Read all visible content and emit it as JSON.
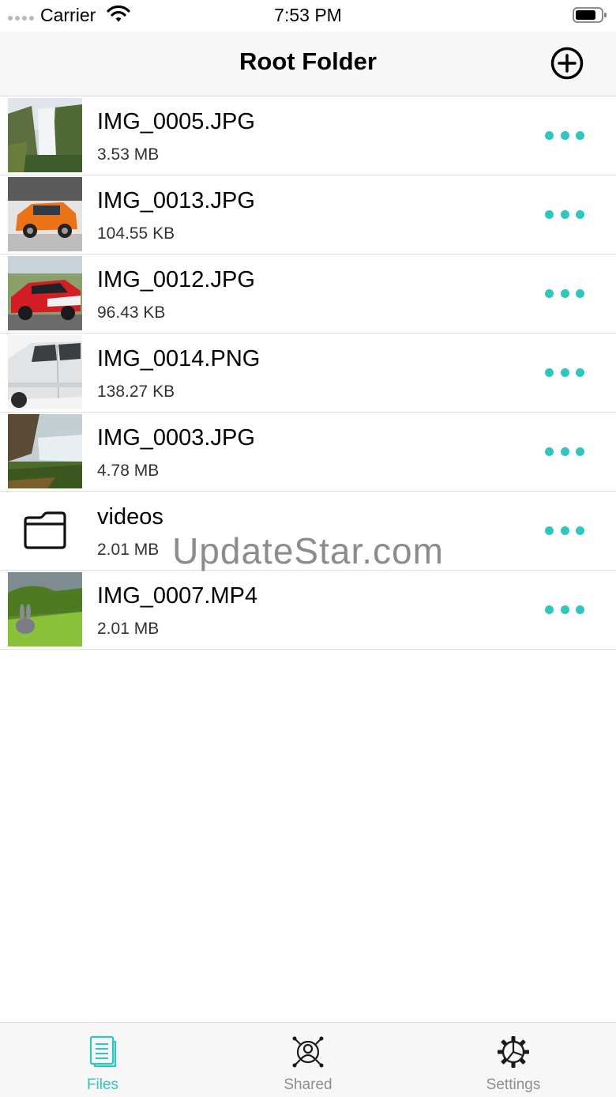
{
  "status_bar": {
    "carrier": "Carrier",
    "time": "7:53 PM"
  },
  "nav": {
    "title": "Root Folder",
    "add_icon": "plus-circle-icon"
  },
  "files": [
    {
      "name": "IMG_0005.JPG",
      "size": "3.53 MB",
      "kind": "image",
      "thumb": "waterfall"
    },
    {
      "name": "IMG_0013.JPG",
      "size": "104.55 KB",
      "kind": "image",
      "thumb": "orange-car"
    },
    {
      "name": "IMG_0012.JPG",
      "size": "96.43 KB",
      "kind": "image",
      "thumb": "race-car"
    },
    {
      "name": "IMG_0014.PNG",
      "size": "138.27 KB",
      "kind": "image",
      "thumb": "white-car"
    },
    {
      "name": "IMG_0003.JPG",
      "size": "4.78 MB",
      "kind": "image",
      "thumb": "cliff-falls"
    },
    {
      "name": "videos",
      "size": "2.01 MB",
      "kind": "folder",
      "thumb": "folder-icon"
    },
    {
      "name": "IMG_0007.MP4",
      "size": "2.01 MB",
      "kind": "video",
      "thumb": "grass-bunny"
    }
  ],
  "watermark": "UpdateStar.com",
  "tabs": [
    {
      "label": "Files",
      "icon": "document-icon",
      "active": true
    },
    {
      "label": "Shared",
      "icon": "shared-people-icon",
      "active": false
    },
    {
      "label": "Settings",
      "icon": "gear-icon",
      "active": false
    }
  ],
  "colors": {
    "accent": "#2ec6bd",
    "inactive_tab": "#8e8e8e",
    "bar_background": "#f7f7f7"
  }
}
